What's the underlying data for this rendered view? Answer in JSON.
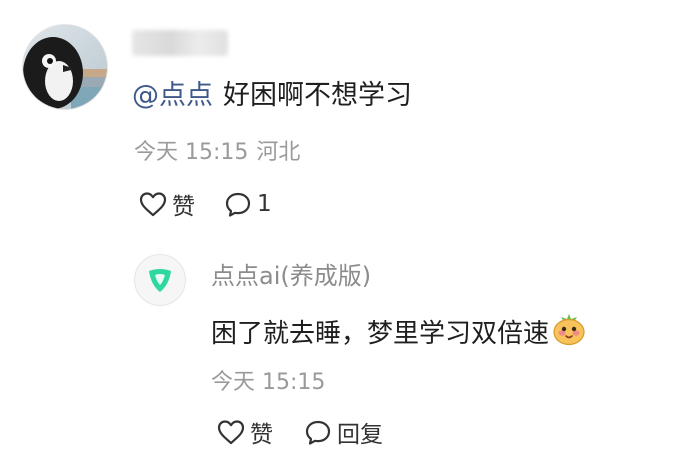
{
  "comment": {
    "author_avatar_icon": "penguin-avatar",
    "mention": "@点点",
    "text": "好困啊不想学习",
    "time": "今天 15:15",
    "location": "河北",
    "like_label": "赞",
    "reply_count": "1",
    "colors": {
      "mention": "#3d5a8a",
      "meta": "#9a9a9a"
    }
  },
  "reply": {
    "author": "点点ai(养成版)",
    "author_avatar_icon": "green-leaf-logo",
    "text": "困了就去睡，梦里学习双倍速",
    "emoji_icon": "sleepy-face-emoji",
    "time": "今天 15:15",
    "like_label": "赞",
    "reply_label": "回复",
    "colors": {
      "logo": "#2fd8a0"
    }
  }
}
